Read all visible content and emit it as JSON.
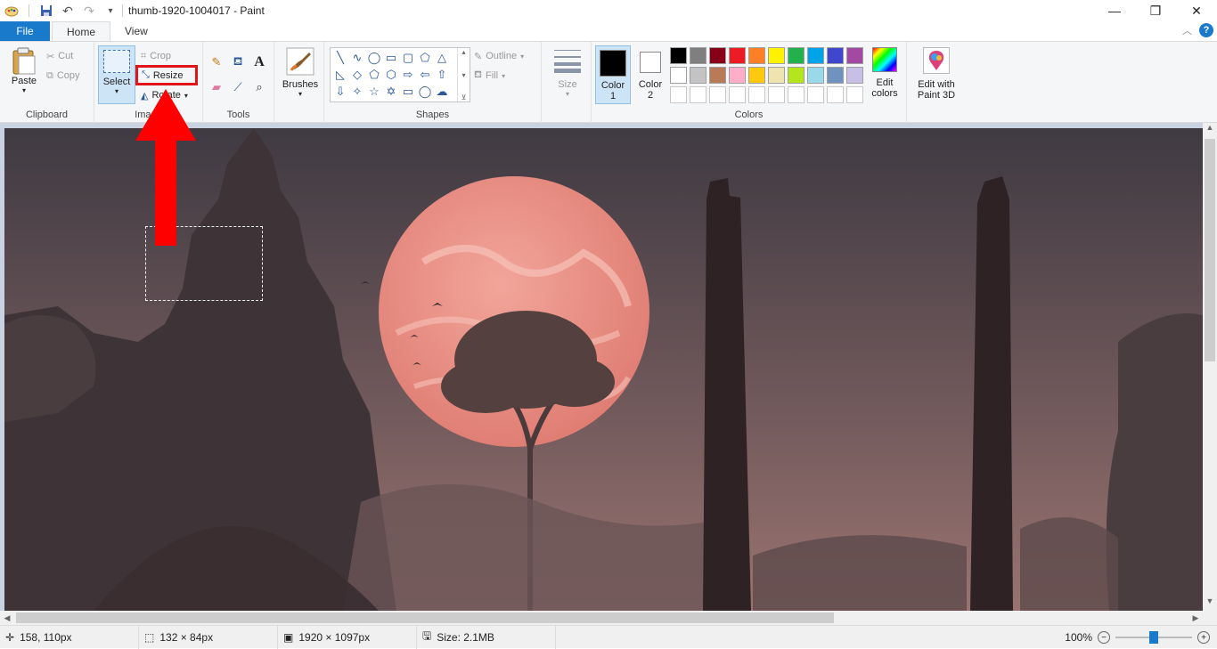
{
  "window": {
    "title": "thumb-1920-1004017 - Paint"
  },
  "tabs": {
    "file": "File",
    "home": "Home",
    "view": "View"
  },
  "ribbon": {
    "clipboard": {
      "label": "Clipboard",
      "paste": "Paste",
      "cut": "Cut",
      "copy": "Copy"
    },
    "image": {
      "label": "Image",
      "select": "Select",
      "crop": "Crop",
      "resize": "Resize",
      "rotate": "Rotate"
    },
    "tools": {
      "label": "Tools"
    },
    "brushes": {
      "label": "Brushes"
    },
    "shapes": {
      "label": "Shapes",
      "outline": "Outline",
      "fill": "Fill"
    },
    "size": {
      "label": "Size"
    },
    "colors": {
      "label": "Colors",
      "color1_line1": "Color",
      "color1_line2": "1",
      "color2_line1": "Color",
      "color2_line2": "2",
      "edit_line1": "Edit",
      "edit_line2": "colors",
      "paint3d_line1": "Edit with",
      "paint3d_line2": "Paint 3D",
      "color1": "#000000",
      "color2": "#ffffff",
      "palette_row1": [
        "#000000",
        "#7f7f7f",
        "#880015",
        "#ed1c24",
        "#ff7f27",
        "#fff200",
        "#22b14c",
        "#00a2e8",
        "#3f48cc",
        "#a349a4"
      ],
      "palette_row2": [
        "#ffffff",
        "#c3c3c3",
        "#b97a57",
        "#ffaec9",
        "#ffc90e",
        "#efe4b0",
        "#b5e61d",
        "#99d9ea",
        "#7092be",
        "#c8bfe7"
      ],
      "palette_row3": [
        "#ffffff",
        "#ffffff",
        "#ffffff",
        "#ffffff",
        "#ffffff",
        "#ffffff",
        "#ffffff",
        "#ffffff",
        "#ffffff",
        "#ffffff"
      ]
    }
  },
  "status": {
    "cursor_pos": "158, 110px",
    "selection_size": "132 × 84px",
    "image_size": "1920 × 1097px",
    "file_size": "Size: 2.1MB",
    "zoom": "100%"
  },
  "annotation": {
    "highlight_color": "#e0151b",
    "arrow_color": "#ff0000"
  }
}
